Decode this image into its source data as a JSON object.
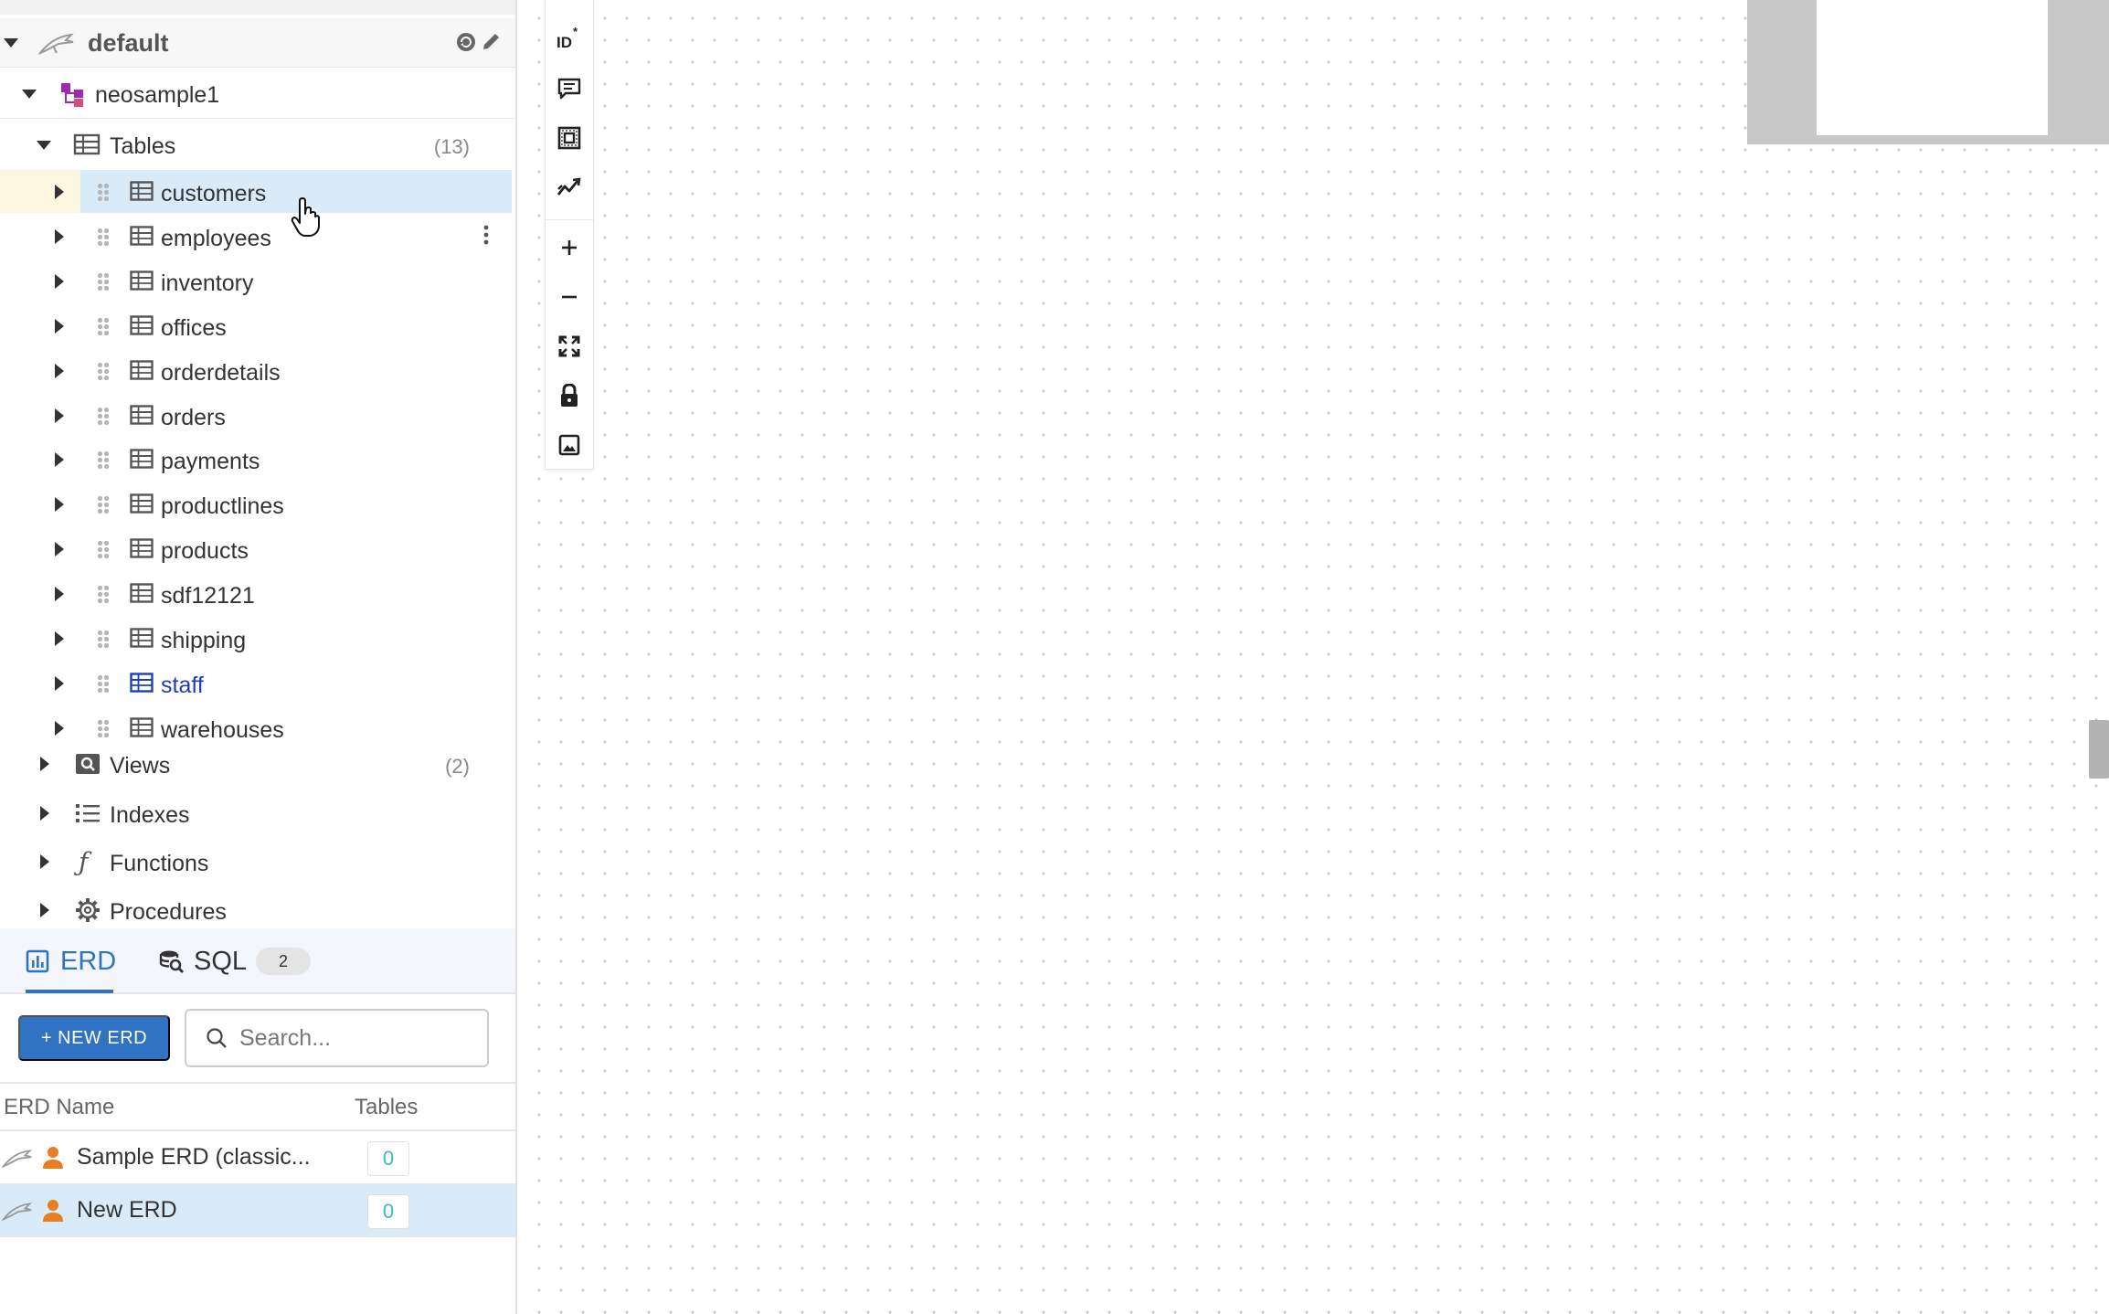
{
  "connection": {
    "name": "default"
  },
  "database": {
    "name": "neosample1"
  },
  "tree": {
    "tables_label": "Tables",
    "tables_count": "(13)",
    "tables": [
      "customers",
      "employees",
      "inventory",
      "offices",
      "orderdetails",
      "orders",
      "payments",
      "productlines",
      "products",
      "sdf12121",
      "shipping",
      "staff",
      "warehouses"
    ],
    "selected_table": "customers",
    "highlighted_table": "staff",
    "views_label": "Views",
    "views_count": "(2)",
    "indexes_label": "Indexes",
    "functions_label": "Functions",
    "procedures_label": "Procedures"
  },
  "panel": {
    "tabs": [
      {
        "label": "ERD",
        "active": true
      },
      {
        "label": "SQL",
        "badge": "2"
      }
    ],
    "new_button": "+ NEW ERD",
    "search_placeholder": "Search...",
    "columns": {
      "name": "ERD Name",
      "tables": "Tables"
    },
    "erds": [
      {
        "name": "Sample ERD (classic...",
        "tables": "0"
      },
      {
        "name": "New ERD",
        "tables": "0",
        "selected": true
      }
    ]
  },
  "toolbar": {
    "tools": [
      "id-toggle-icon",
      "comment-icon",
      "frame-icon",
      "trend-icon",
      "zoom-in-icon",
      "zoom-out-icon",
      "fit-view-icon",
      "lock-icon",
      "image-export-icon"
    ]
  },
  "colors": {
    "accent": "#2f73c2",
    "selection": "#d9eaf9",
    "highlight_text": "#1f3fb0",
    "db_icon": "#9c2bb0",
    "user_icon": "#e67e22"
  }
}
